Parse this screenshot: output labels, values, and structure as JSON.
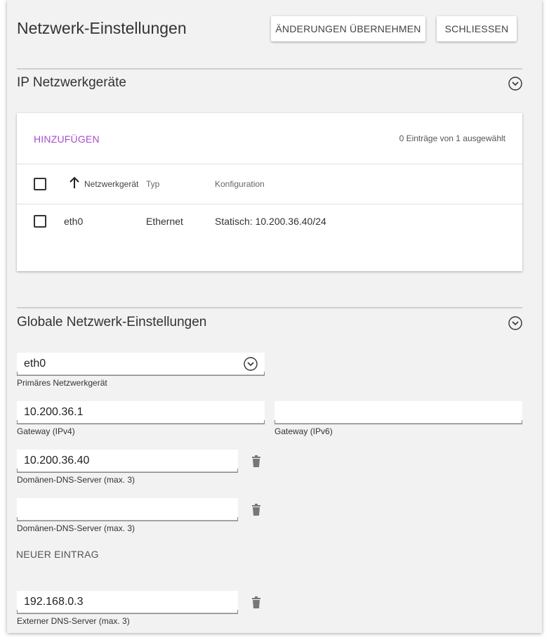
{
  "dialog": {
    "title": "Netzwerk-Einstellungen",
    "apply_button": "ÄNDERUNGEN ÜBERNEHMEN",
    "close_button": "SCHLIESSEN"
  },
  "devices_section": {
    "title": "IP Netzwerkgeräte",
    "add_link": "HINZUFÜGEN",
    "selection_count": "0 Einträge von 1 ausgewählt",
    "columns": [
      "Netzwerkgerät",
      "Typ",
      "Konfiguration"
    ],
    "rows": [
      {
        "device": "eth0",
        "type": "Ethernet",
        "config": "Statisch: 10.200.36.40/24"
      }
    ]
  },
  "global_section": {
    "title": "Globale Netzwerk-Einstellungen",
    "primary_device": {
      "value": "eth0",
      "label": "Primäres Netzwerkgerät"
    },
    "gateway_ipv4": {
      "value": "10.200.36.1",
      "label": "Gateway (IPv4)"
    },
    "gateway_ipv6": {
      "value": "",
      "label": "Gateway (IPv6)"
    },
    "domain_dns": [
      {
        "value": "10.200.36.40",
        "label": "Domänen-DNS-Server (max. 3)"
      },
      {
        "value": "",
        "label": "Domänen-DNS-Server (max. 3)"
      }
    ],
    "new_entry": "NEUER EINTRAG",
    "external_dns": [
      {
        "value": "192.168.0.3",
        "label": "Externer DNS-Server (max. 3)"
      }
    ]
  },
  "colors": {
    "accent": "#a64fcb",
    "panel_bg": "#f2f2f2",
    "card_bg": "#ffffff"
  }
}
